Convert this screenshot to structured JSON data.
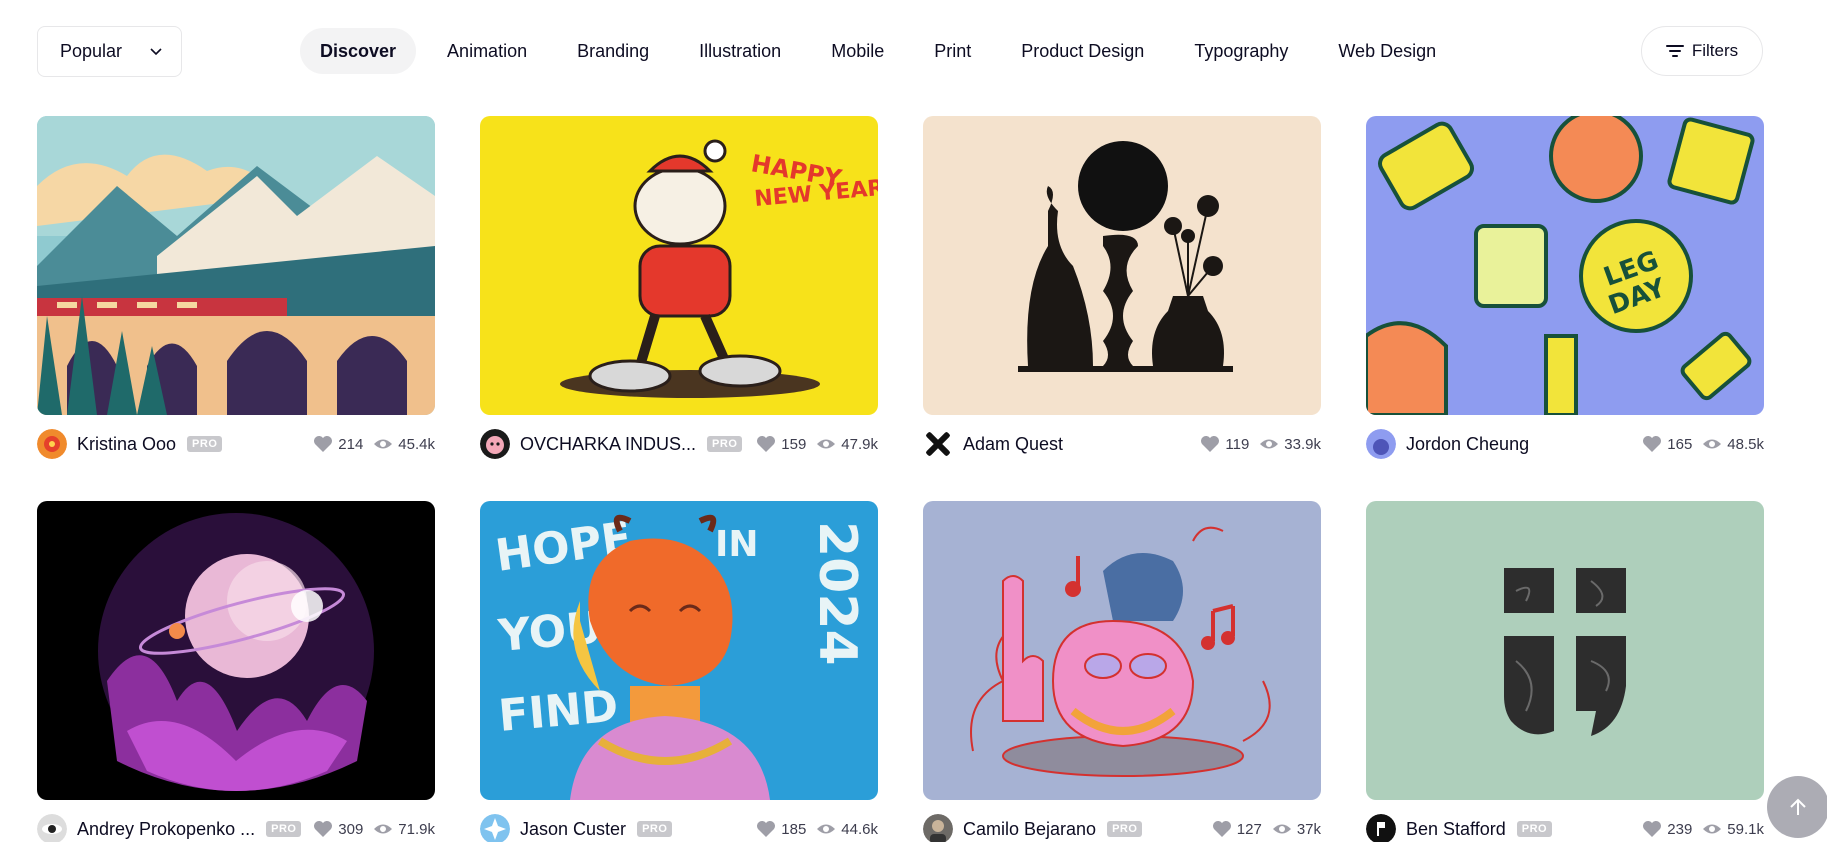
{
  "sort": {
    "selected": "Popular"
  },
  "tabs": [
    {
      "label": "Discover",
      "active": true
    },
    {
      "label": "Animation"
    },
    {
      "label": "Branding"
    },
    {
      "label": "Illustration"
    },
    {
      "label": "Mobile"
    },
    {
      "label": "Print"
    },
    {
      "label": "Product Design"
    },
    {
      "label": "Typography"
    },
    {
      "label": "Web Design"
    }
  ],
  "filters": {
    "label": "Filters"
  },
  "shots": [
    {
      "author": "Kristina Ooo",
      "pro": "PRO",
      "likes": "214",
      "views": "45.4k"
    },
    {
      "author": "OVCHARKA INDUS...",
      "pro": "PRO",
      "likes": "159",
      "views": "47.9k"
    },
    {
      "author": "Adam Quest",
      "pro": "",
      "likes": "119",
      "views": "33.9k"
    },
    {
      "author": "Jordon Cheung",
      "pro": "",
      "likes": "165",
      "views": "48.5k"
    },
    {
      "author": "Andrey Prokopenko ...",
      "pro": "PRO",
      "likes": "309",
      "views": "71.9k"
    },
    {
      "author": "Jason Custer",
      "pro": "PRO",
      "likes": "185",
      "views": "44.6k"
    },
    {
      "author": "Camilo Bejarano",
      "pro": "PRO",
      "likes": "127",
      "views": "37k"
    },
    {
      "author": "Ben Stafford",
      "pro": "PRO",
      "likes": "239",
      "views": "59.1k"
    }
  ],
  "thumb_text": {
    "happy_new_year": [
      "HAPPY",
      "NEW YEAR"
    ],
    "hope_you_find": [
      "HOPE",
      "YOU",
      "FIND",
      "IN",
      "2024"
    ],
    "leg_day": [
      "LEG",
      "DAY"
    ]
  },
  "colors": {
    "pro_badge": "#c8c8cc",
    "tab_active_bg": "#f3f3f4",
    "stat_icon": "#9e9ea7"
  }
}
